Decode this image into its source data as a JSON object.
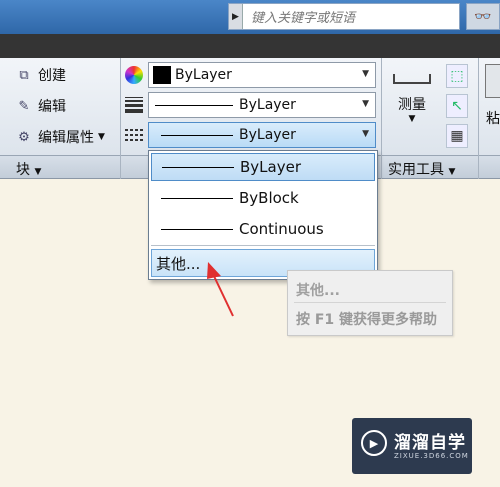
{
  "search": {
    "placeholder": "键入关键字或短语"
  },
  "ribbon": {
    "block_panel": {
      "items": [
        {
          "label": "创建",
          "icon": "block-create-icon"
        },
        {
          "label": "编辑",
          "icon": "block-edit-icon"
        },
        {
          "label": "编辑属性",
          "icon": "edit-attributes-icon"
        }
      ],
      "title": "块"
    },
    "properties": {
      "color_value": "ByLayer",
      "lineweight_value": "ByLayer",
      "linetype_value": "ByLayer"
    },
    "utilities": {
      "measure_label": "测量",
      "title": "实用工具"
    },
    "edge_label": "粘"
  },
  "linetype_dropdown": {
    "options": [
      {
        "label": "ByLayer",
        "selected": true
      },
      {
        "label": "ByBlock",
        "selected": false
      },
      {
        "label": "Continuous",
        "selected": false
      },
      {
        "label": "其他...",
        "selected": false
      }
    ]
  },
  "tooltip": {
    "title": "其他...",
    "help": "按 F1 键获得更多帮助"
  },
  "watermark": {
    "title": "溜溜自学",
    "subtitle": "ZIXUE.3D66.COM"
  },
  "colors": {
    "accent": "#4f8cc8",
    "annotation_arrow": "#e03030",
    "title_bar": "#3a76b8"
  }
}
